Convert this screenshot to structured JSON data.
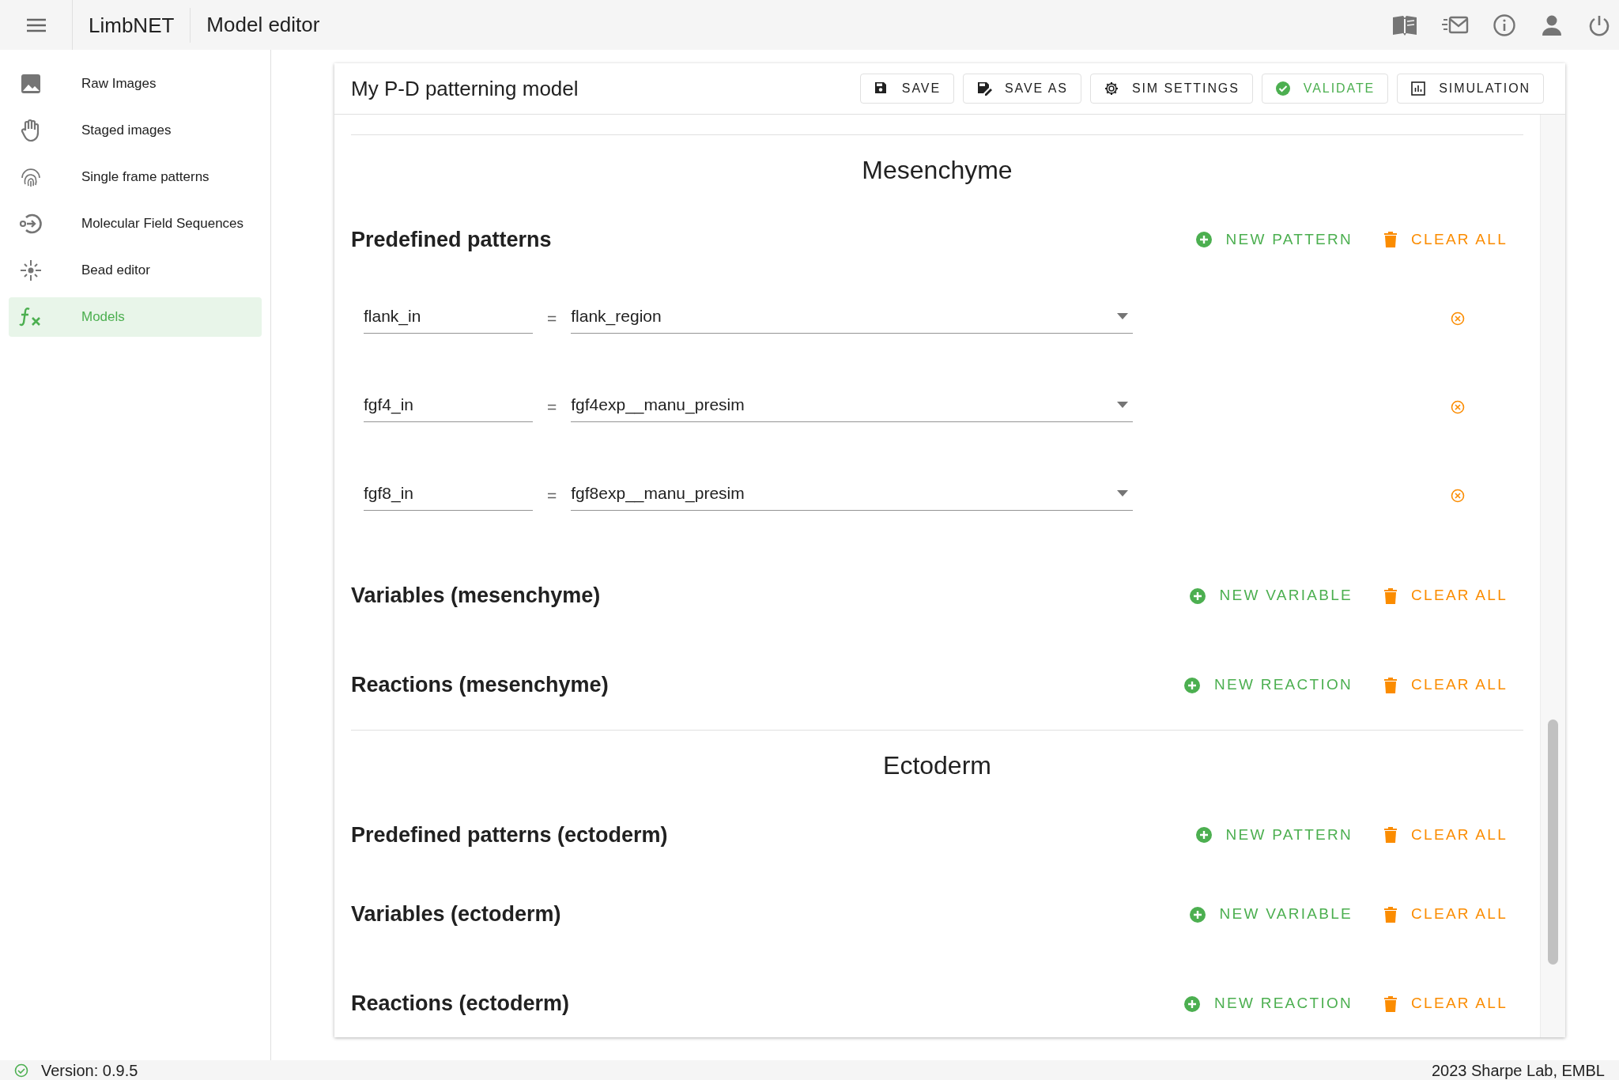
{
  "app_bar": {
    "app_name": "LimbNET",
    "page_title": "Model editor"
  },
  "sidebar": {
    "items": [
      {
        "label": "Raw Images",
        "kind": "image",
        "selected": false
      },
      {
        "label": "Staged images",
        "kind": "hand",
        "selected": false
      },
      {
        "label": "Single frame patterns",
        "kind": "fingerprint",
        "selected": false
      },
      {
        "label": "Molecular Field Sequences",
        "kind": "sequence",
        "selected": false
      },
      {
        "label": "Bead editor",
        "kind": "bead",
        "selected": false
      },
      {
        "label": "Models",
        "kind": "function",
        "selected": true
      }
    ]
  },
  "editor": {
    "title": "My P-D patterning model",
    "toolbar": [
      {
        "label": "SAVE",
        "kind": "save"
      },
      {
        "label": "SAVE AS",
        "kind": "save_as"
      },
      {
        "label": "SIM SETTINGS",
        "kind": "settings"
      },
      {
        "label": "VALIDATE",
        "kind": "validate"
      },
      {
        "label": "SIMULATION",
        "kind": "simulation"
      }
    ],
    "sections": [
      {
        "title": "Mesenchyme",
        "groups": [
          {
            "title": "Predefined patterns",
            "actions": [
              {
                "label": "NEW PATTERN",
                "kind": "add"
              },
              {
                "label": "CLEAR ALL",
                "kind": "clear"
              }
            ],
            "rows": [
              {
                "name": "flank_in",
                "operator": "=",
                "pattern": "flank_region"
              },
              {
                "name": "fgf4_in",
                "operator": "=",
                "pattern": "fgf4exp__manu_presim"
              },
              {
                "name": "fgf8_in",
                "operator": "=",
                "pattern": "fgf8exp__manu_presim"
              }
            ]
          },
          {
            "title": "Variables (mesenchyme)",
            "actions": [
              {
                "label": "NEW VARIABLE",
                "kind": "add"
              },
              {
                "label": "CLEAR ALL",
                "kind": "clear"
              }
            ]
          },
          {
            "title": "Reactions (mesenchyme)",
            "actions": [
              {
                "label": "NEW REACTION",
                "kind": "add"
              },
              {
                "label": "CLEAR ALL",
                "kind": "clear"
              }
            ]
          }
        ]
      },
      {
        "title": "Ectoderm",
        "groups": [
          {
            "title": "Predefined patterns (ectoderm)",
            "actions": [
              {
                "label": "NEW PATTERN",
                "kind": "add"
              },
              {
                "label": "CLEAR ALL",
                "kind": "clear"
              }
            ]
          },
          {
            "title": "Variables (ectoderm)",
            "actions": [
              {
                "label": "NEW VARIABLE",
                "kind": "add"
              },
              {
                "label": "CLEAR ALL",
                "kind": "clear"
              }
            ]
          },
          {
            "title": "Reactions (ectoderm)",
            "actions": [
              {
                "label": "NEW REACTION",
                "kind": "add"
              },
              {
                "label": "CLEAR ALL",
                "kind": "clear"
              }
            ]
          }
        ]
      }
    ]
  },
  "status_bar": {
    "version": "Version: 0.9.5",
    "credit": "2023 Sharpe Lab, EMBL"
  }
}
